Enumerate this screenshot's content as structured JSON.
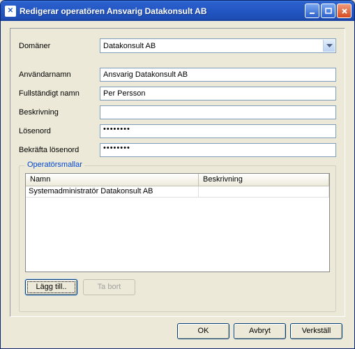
{
  "window": {
    "title": "Redigerar operatören Ansvarig Datakonsult AB"
  },
  "form": {
    "domain_label": "Domäner",
    "domain_value": "Datakonsult AB",
    "username_label": "Användarnamn",
    "username_value": "Ansvarig Datakonsult AB",
    "fullname_label": "Fullständigt namn",
    "fullname_value": "Per Persson",
    "description_label": "Beskrivning",
    "description_value": "",
    "password_label": "Lösenord",
    "password_value": "••••••••",
    "confirm_label": "Bekräfta lösenord",
    "confirm_value": "••••••••"
  },
  "templates": {
    "legend": "Operatörsmallar",
    "header_name": "Namn",
    "header_desc": "Beskrivning",
    "rows": [
      {
        "name": "Systemadministratör Datakonsult AB",
        "desc": ""
      }
    ],
    "add_button": "Lägg till..",
    "remove_button": "Ta bort"
  },
  "buttons": {
    "ok": "OK",
    "cancel": "Avbryt",
    "apply": "Verkställ"
  }
}
